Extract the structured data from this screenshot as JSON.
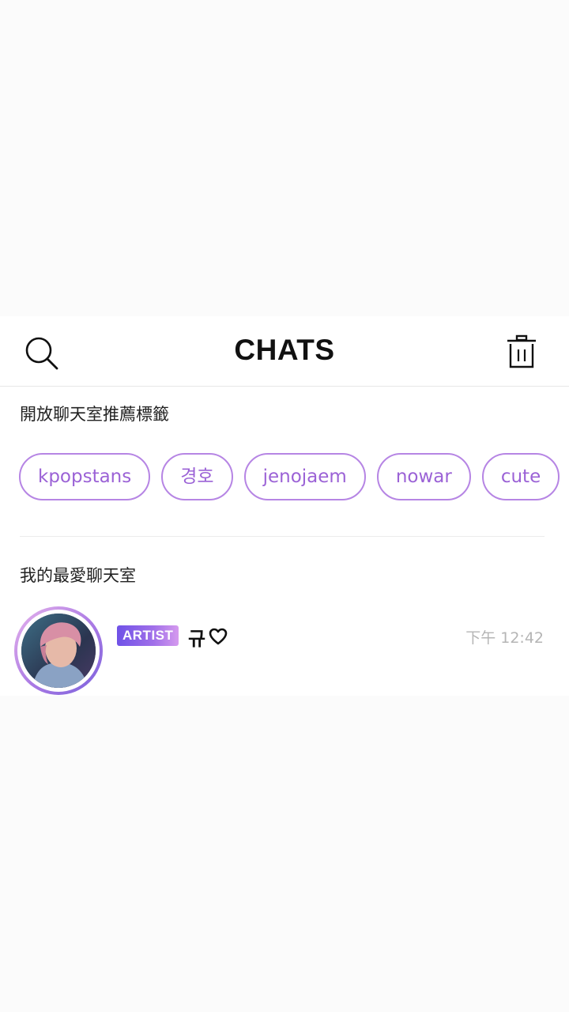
{
  "header": {
    "title": "CHATS",
    "search_icon": "search-icon",
    "trash_icon": "trash-icon"
  },
  "tags_section": {
    "title": "開放聊天室推薦標籤",
    "tags": [
      "kpopstans",
      "경호",
      "jenojaem",
      "nowar",
      "cute"
    ]
  },
  "favorites_section": {
    "title": "我的最愛聊天室",
    "chats": [
      {
        "badge": "ARTIST",
        "name": "규",
        "name_icon": "heart-icon",
        "time": "下午 12:42"
      }
    ]
  },
  "colors": {
    "accent": "#9b62d6",
    "tag_border": "#b685e4",
    "badge_gradient_start": "#6f52e7",
    "badge_gradient_end": "#d59aee",
    "time_text": "#b5b5b5"
  }
}
